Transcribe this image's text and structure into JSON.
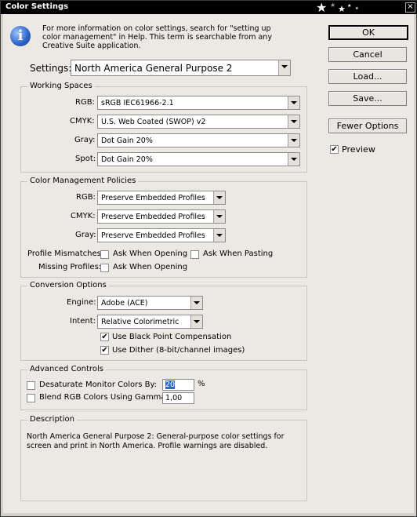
{
  "window": {
    "title": "Color Settings",
    "close_glyph": "×"
  },
  "info": {
    "icon": "info-icon",
    "text": "For more information on color settings, search for \"setting up color management\" in Help. This term is searchable from any Creative Suite application."
  },
  "buttons": {
    "ok": "OK",
    "cancel": "Cancel",
    "load": "Load...",
    "save": "Save...",
    "fewer_options": "Fewer Options"
  },
  "preview": {
    "label": "Preview",
    "checked": true
  },
  "settings": {
    "label": "Settings:",
    "value": "North America General Purpose 2"
  },
  "working_spaces": {
    "title": "Working Spaces",
    "rgb_label": "RGB:",
    "rgb": "sRGB IEC61966-2.1",
    "cmyk_label": "CMYK:",
    "cmyk": "U.S. Web Coated (SWOP) v2",
    "gray_label": "Gray:",
    "gray": "Dot Gain 20%",
    "spot_label": "Spot:",
    "spot": "Dot Gain 20%"
  },
  "policies": {
    "title": "Color Management Policies",
    "rgb_label": "RGB:",
    "rgb": "Preserve Embedded Profiles",
    "cmyk_label": "CMYK:",
    "cmyk": "Preserve Embedded Profiles",
    "gray_label": "Gray:",
    "gray": "Preserve Embedded Profiles",
    "mismatch_label": "Profile Mismatches:",
    "ask_opening": "Ask When Opening",
    "ask_pasting": "Ask When Pasting",
    "missing_label": "Missing Profiles:",
    "missing_ask_opening": "Ask When Opening"
  },
  "conversion": {
    "title": "Conversion Options",
    "engine_label": "Engine:",
    "engine": "Adobe (ACE)",
    "intent_label": "Intent:",
    "intent": "Relative Colorimetric",
    "bpc": "Use Black Point Compensation",
    "dither": "Use Dither (8-bit/channel images)"
  },
  "advanced": {
    "title": "Advanced Controls",
    "desaturate": "Desaturate Monitor Colors By:",
    "desaturate_value": "20",
    "percent": "%",
    "blend": "Blend RGB Colors Using Gamma:",
    "blend_value": "1,00"
  },
  "description": {
    "title": "Description",
    "text": "North America General Purpose 2:  General-purpose color settings for screen and print in North America. Profile warnings are disabled."
  }
}
